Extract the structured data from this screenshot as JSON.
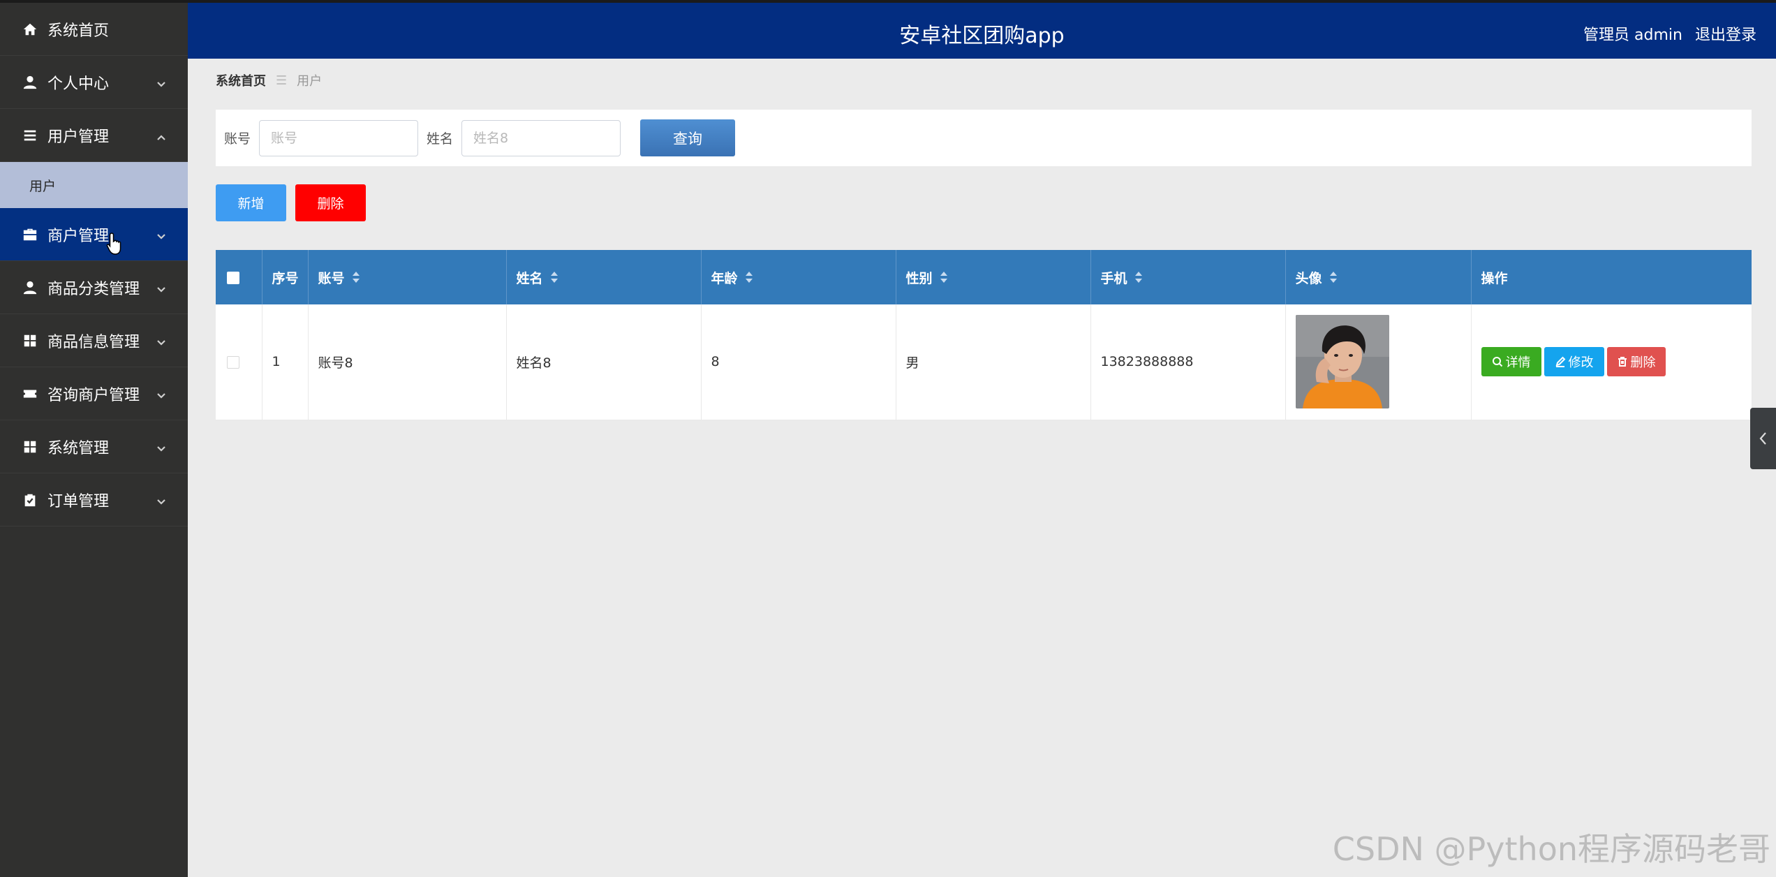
{
  "header": {
    "title": "安卓社区团购app",
    "user_label": "管理员 admin",
    "logout_label": "退出登录"
  },
  "sidebar": {
    "items": [
      {
        "label": "系统首页",
        "icon": "home-icon"
      },
      {
        "label": "个人中心",
        "icon": "person-icon"
      },
      {
        "label": "用户管理",
        "icon": "list-icon",
        "expanded": true
      },
      {
        "label": "商户管理",
        "icon": "briefcase-icon",
        "active": true
      },
      {
        "label": "商品分类管理",
        "icon": "person-icon"
      },
      {
        "label": "商品信息管理",
        "icon": "grid-icon"
      },
      {
        "label": "咨询商户管理",
        "icon": "ticket-icon"
      },
      {
        "label": "系统管理",
        "icon": "grid-icon"
      },
      {
        "label": "订单管理",
        "icon": "clipboard-icon"
      }
    ],
    "subitems": [
      {
        "label": "用户"
      }
    ]
  },
  "breadcrumb": {
    "home": "系统首页",
    "separator": "☰",
    "current": "用户"
  },
  "search": {
    "account_label": "账号",
    "account_placeholder": "账号",
    "account_value": "",
    "name_label": "姓名",
    "name_placeholder": "姓名8",
    "name_value": "",
    "query_button": "查询"
  },
  "actions": {
    "add_label": "新增",
    "delete_label": "删除"
  },
  "table": {
    "headers": [
      "",
      "序号",
      "账号",
      "姓名",
      "年龄",
      "性别",
      "手机",
      "头像",
      "操作"
    ],
    "rows": [
      {
        "index": "1",
        "account": "账号8",
        "name": "姓名8",
        "age": "8",
        "gender": "男",
        "phone": "13823888888"
      }
    ],
    "row_actions": {
      "detail": "详情",
      "edit": "修改",
      "delete": "删除"
    }
  },
  "watermark": "CSDN @Python程序源码老哥",
  "colors": {
    "sidebar_bg": "#30302f",
    "header_bg": "#032d81",
    "active_menu": "#033082",
    "table_header": "#337ab9",
    "detail_btn": "#3aab21",
    "edit_btn": "#14a4ee",
    "delete_btn": "#e0514f",
    "add_btn": "#3e9cf2",
    "batch_delete_btn": "#ff0000"
  }
}
